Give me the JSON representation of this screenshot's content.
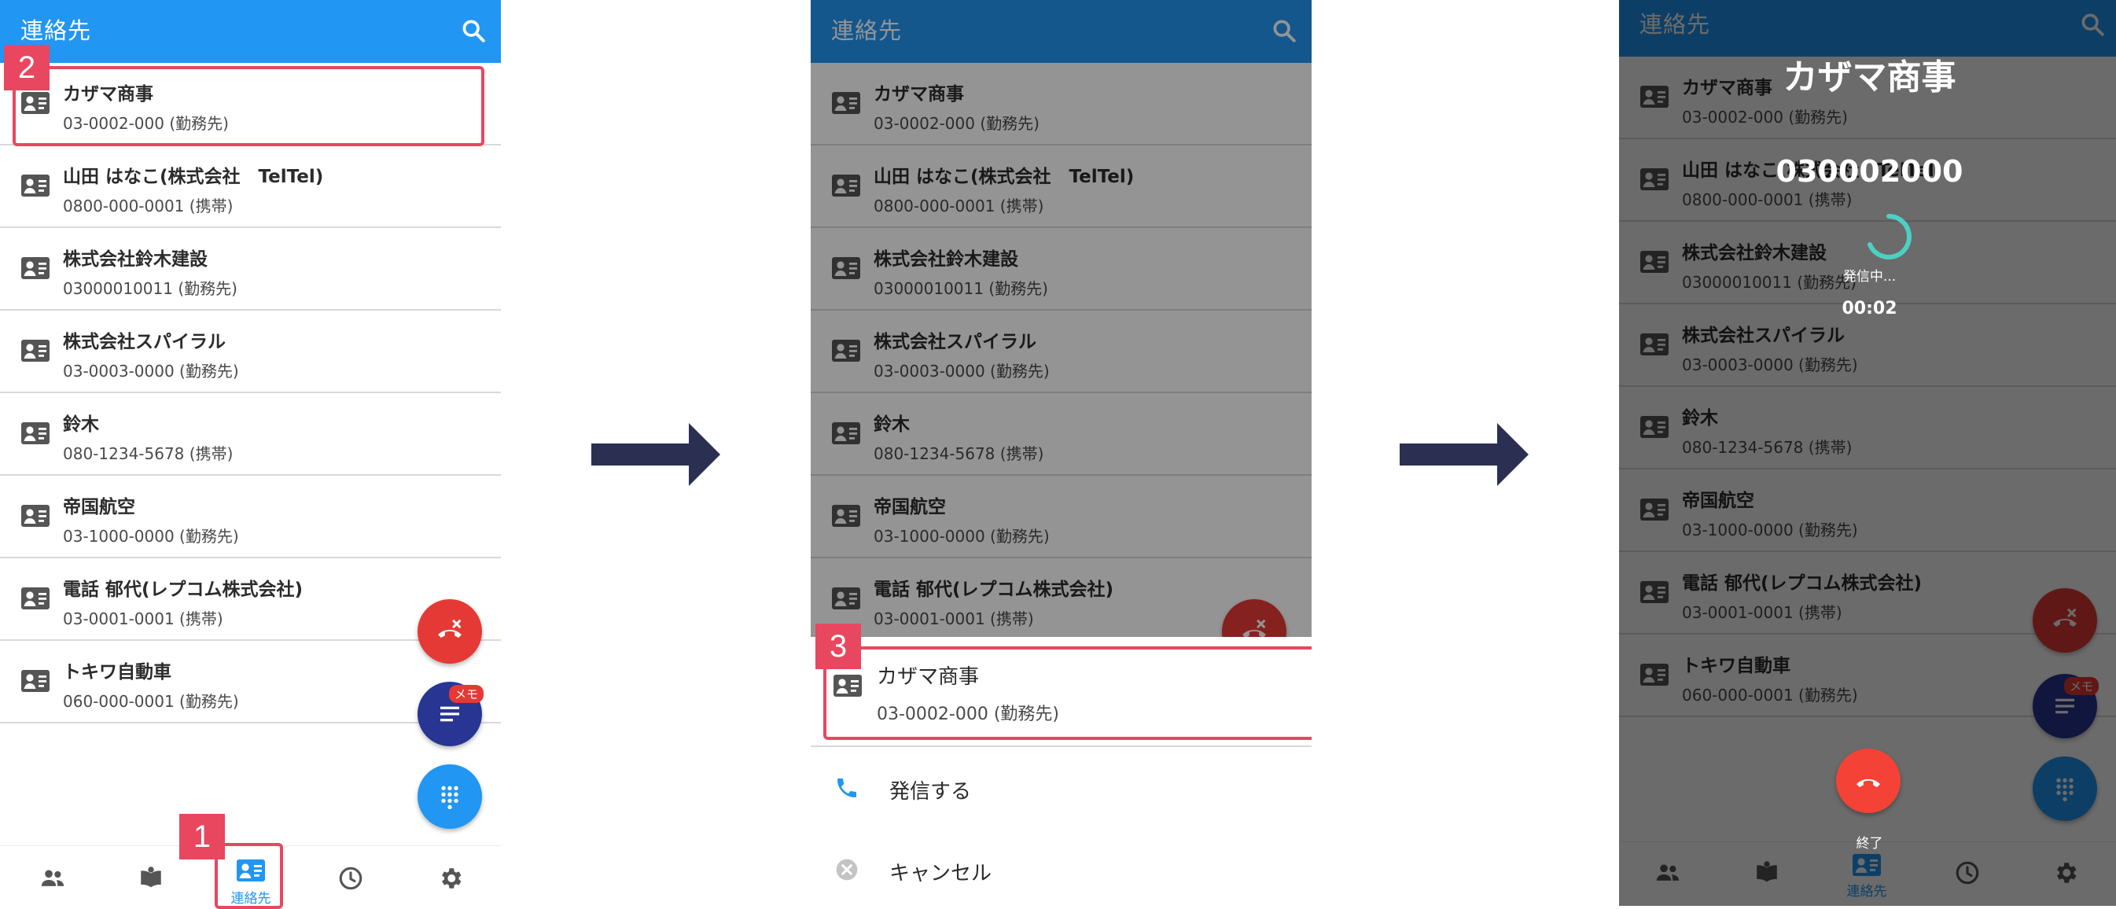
{
  "app_title": "連絡先",
  "contacts": [
    {
      "name": "カザマ商事",
      "number": "03-0002-000 (勤務先)"
    },
    {
      "name": "山田 はなこ(株式会社　TelTel)",
      "number": "0800-000-0001 (携帯)"
    },
    {
      "name": "株式会社鈴木建設",
      "number": "03000010011 (勤務先)"
    },
    {
      "name": "株式会社スパイラル",
      "number": "03-0003-0000 (勤務先)"
    },
    {
      "name": "鈴木",
      "number": "080-1234-5678 (携帯)"
    },
    {
      "name": "帝国航空",
      "number": "03-1000-0000 (勤務先)"
    },
    {
      "name": "電話 郁代(レプコム株式会社)",
      "number": "03-0001-0001 (携帯)"
    },
    {
      "name": "トキワ自動車",
      "number": "060-000-0001 (勤務先)"
    }
  ],
  "fab": {
    "memo_badge": "メモ"
  },
  "nav": {
    "contacts_label": "連絡先"
  },
  "steps": {
    "step1": "1",
    "step2": "2",
    "step3": "3"
  },
  "sheet": {
    "selected_name": "カザマ商事",
    "selected_number": "03-0002-000 (勤務先)",
    "call_label": "発信する",
    "cancel_label": "キャンセル"
  },
  "call": {
    "name": "カザマ商事",
    "number": "030002000",
    "status": "発信中...",
    "timer": "00:02",
    "end_label": "終了"
  },
  "colors": {
    "primary": "#2196f3",
    "highlight": "#e8475f",
    "fab_red": "#e53935",
    "fab_navy": "#283593",
    "end_call": "#f44336",
    "arrow": "#2b2f52",
    "spinner": "#4dd0c4"
  },
  "icons": [
    "search-icon",
    "contact-card-icon",
    "hangup-icon",
    "notes-icon",
    "dialpad-icon",
    "people-icon",
    "book-icon",
    "clock-icon",
    "gear-icon",
    "phone-icon",
    "cancel-icon",
    "right-arrow-icon"
  ]
}
